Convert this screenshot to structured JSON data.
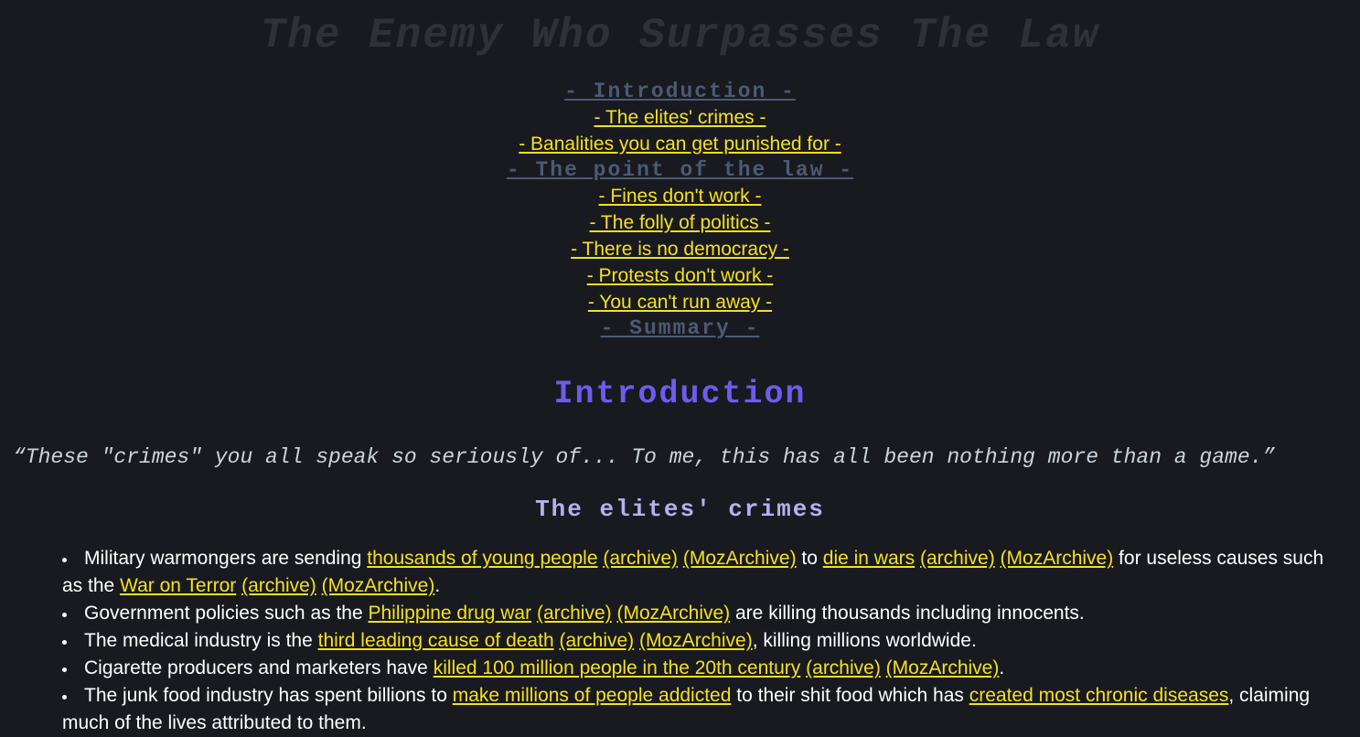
{
  "page": {
    "title": "The Enemy Who Surpasses The Law",
    "background_color": "#181a1f",
    "link_color": "#f5e01e",
    "major_toc_color": "#4c5a75",
    "intro_heading_color": "#6f5bf0",
    "sub_heading_color": "#b7b0f0",
    "body_text_color": "#ffffff",
    "title_color": "#2e3138"
  },
  "toc": {
    "items": [
      {
        "label": "- Introduction -",
        "level": "major"
      },
      {
        "label": "- The elites' crimes -",
        "level": "minor"
      },
      {
        "label": "- Banalities you can get punished for -",
        "level": "minor"
      },
      {
        "label": "- The point of the law -",
        "level": "major"
      },
      {
        "label": "- Fines don't work -",
        "level": "minor"
      },
      {
        "label": "- The folly of politics -",
        "level": "minor"
      },
      {
        "label": "- There is no democracy -",
        "level": "minor"
      },
      {
        "label": "- Protests don't work -",
        "level": "minor"
      },
      {
        "label": "- You can't run away -",
        "level": "minor"
      },
      {
        "label": "- Summary -",
        "level": "major"
      }
    ]
  },
  "sections": {
    "introduction": {
      "heading": "Introduction",
      "quote": "“These \"crimes\" you all speak so seriously of... To me, this has all been nothing more than a game.”",
      "subheading": "The elites' crimes",
      "bullets": [
        {
          "parts": [
            {
              "t": "Military warmongers are sending ",
              "link": false
            },
            {
              "t": "thousands of young people",
              "link": true
            },
            {
              "t": " ",
              "link": false
            },
            {
              "t": "(archive)",
              "link": true
            },
            {
              "t": " ",
              "link": false
            },
            {
              "t": "(MozArchive)",
              "link": true
            },
            {
              "t": " to ",
              "link": false
            },
            {
              "t": "die in wars",
              "link": true
            },
            {
              "t": " ",
              "link": false
            },
            {
              "t": "(archive)",
              "link": true
            },
            {
              "t": " ",
              "link": false
            },
            {
              "t": "(MozArchive)",
              "link": true
            },
            {
              "t": " for useless causes such as the ",
              "link": false
            },
            {
              "t": "War on Terror",
              "link": true
            },
            {
              "t": " ",
              "link": false
            },
            {
              "t": "(archive)",
              "link": true
            },
            {
              "t": " ",
              "link": false
            },
            {
              "t": "(MozArchive)",
              "link": true
            },
            {
              "t": ".",
              "link": false
            }
          ]
        },
        {
          "parts": [
            {
              "t": "Government policies such as the ",
              "link": false
            },
            {
              "t": "Philippine drug war",
              "link": true
            },
            {
              "t": " ",
              "link": false
            },
            {
              "t": "(archive)",
              "link": true
            },
            {
              "t": " ",
              "link": false
            },
            {
              "t": "(MozArchive)",
              "link": true
            },
            {
              "t": " are killing thousands including innocents.",
              "link": false
            }
          ]
        },
        {
          "parts": [
            {
              "t": "The medical industry is the ",
              "link": false
            },
            {
              "t": "third leading cause of death",
              "link": true
            },
            {
              "t": " ",
              "link": false
            },
            {
              "t": "(archive)",
              "link": true
            },
            {
              "t": " ",
              "link": false
            },
            {
              "t": "(MozArchive)",
              "link": true
            },
            {
              "t": ", killing millions worldwide.",
              "link": false
            }
          ]
        },
        {
          "parts": [
            {
              "t": "Cigarette producers and marketers have ",
              "link": false
            },
            {
              "t": "killed 100 million people in the 20th century",
              "link": true
            },
            {
              "t": " ",
              "link": false
            },
            {
              "t": "(archive)",
              "link": true
            },
            {
              "t": " ",
              "link": false
            },
            {
              "t": "(MozArchive)",
              "link": true
            },
            {
              "t": ".",
              "link": false
            }
          ]
        },
        {
          "parts": [
            {
              "t": "The junk food industry has spent billions to ",
              "link": false
            },
            {
              "t": "make millions of people addicted",
              "link": true
            },
            {
              "t": " to their shit food which has ",
              "link": false
            },
            {
              "t": "created most chronic diseases",
              "link": true
            },
            {
              "t": ", claiming much of the lives attributed to them.",
              "link": false
            }
          ]
        }
      ]
    }
  }
}
